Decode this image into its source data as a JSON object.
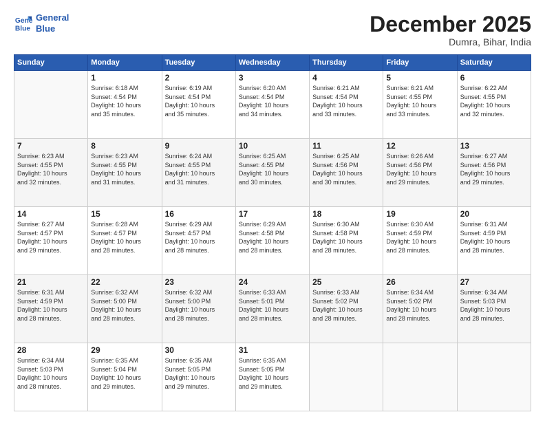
{
  "header": {
    "logo_line1": "General",
    "logo_line2": "Blue",
    "month": "December 2025",
    "location": "Dumra, Bihar, India"
  },
  "days_of_week": [
    "Sunday",
    "Monday",
    "Tuesday",
    "Wednesday",
    "Thursday",
    "Friday",
    "Saturday"
  ],
  "weeks": [
    [
      {
        "day": "",
        "detail": ""
      },
      {
        "day": "1",
        "detail": "Sunrise: 6:18 AM\nSunset: 4:54 PM\nDaylight: 10 hours\nand 35 minutes."
      },
      {
        "day": "2",
        "detail": "Sunrise: 6:19 AM\nSunset: 4:54 PM\nDaylight: 10 hours\nand 35 minutes."
      },
      {
        "day": "3",
        "detail": "Sunrise: 6:20 AM\nSunset: 4:54 PM\nDaylight: 10 hours\nand 34 minutes."
      },
      {
        "day": "4",
        "detail": "Sunrise: 6:21 AM\nSunset: 4:54 PM\nDaylight: 10 hours\nand 33 minutes."
      },
      {
        "day": "5",
        "detail": "Sunrise: 6:21 AM\nSunset: 4:55 PM\nDaylight: 10 hours\nand 33 minutes."
      },
      {
        "day": "6",
        "detail": "Sunrise: 6:22 AM\nSunset: 4:55 PM\nDaylight: 10 hours\nand 32 minutes."
      }
    ],
    [
      {
        "day": "7",
        "detail": "Sunrise: 6:23 AM\nSunset: 4:55 PM\nDaylight: 10 hours\nand 32 minutes."
      },
      {
        "day": "8",
        "detail": "Sunrise: 6:23 AM\nSunset: 4:55 PM\nDaylight: 10 hours\nand 31 minutes."
      },
      {
        "day": "9",
        "detail": "Sunrise: 6:24 AM\nSunset: 4:55 PM\nDaylight: 10 hours\nand 31 minutes."
      },
      {
        "day": "10",
        "detail": "Sunrise: 6:25 AM\nSunset: 4:55 PM\nDaylight: 10 hours\nand 30 minutes."
      },
      {
        "day": "11",
        "detail": "Sunrise: 6:25 AM\nSunset: 4:56 PM\nDaylight: 10 hours\nand 30 minutes."
      },
      {
        "day": "12",
        "detail": "Sunrise: 6:26 AM\nSunset: 4:56 PM\nDaylight: 10 hours\nand 29 minutes."
      },
      {
        "day": "13",
        "detail": "Sunrise: 6:27 AM\nSunset: 4:56 PM\nDaylight: 10 hours\nand 29 minutes."
      }
    ],
    [
      {
        "day": "14",
        "detail": "Sunrise: 6:27 AM\nSunset: 4:57 PM\nDaylight: 10 hours\nand 29 minutes."
      },
      {
        "day": "15",
        "detail": "Sunrise: 6:28 AM\nSunset: 4:57 PM\nDaylight: 10 hours\nand 28 minutes."
      },
      {
        "day": "16",
        "detail": "Sunrise: 6:29 AM\nSunset: 4:57 PM\nDaylight: 10 hours\nand 28 minutes."
      },
      {
        "day": "17",
        "detail": "Sunrise: 6:29 AM\nSunset: 4:58 PM\nDaylight: 10 hours\nand 28 minutes."
      },
      {
        "day": "18",
        "detail": "Sunrise: 6:30 AM\nSunset: 4:58 PM\nDaylight: 10 hours\nand 28 minutes."
      },
      {
        "day": "19",
        "detail": "Sunrise: 6:30 AM\nSunset: 4:59 PM\nDaylight: 10 hours\nand 28 minutes."
      },
      {
        "day": "20",
        "detail": "Sunrise: 6:31 AM\nSunset: 4:59 PM\nDaylight: 10 hours\nand 28 minutes."
      }
    ],
    [
      {
        "day": "21",
        "detail": "Sunrise: 6:31 AM\nSunset: 4:59 PM\nDaylight: 10 hours\nand 28 minutes."
      },
      {
        "day": "22",
        "detail": "Sunrise: 6:32 AM\nSunset: 5:00 PM\nDaylight: 10 hours\nand 28 minutes."
      },
      {
        "day": "23",
        "detail": "Sunrise: 6:32 AM\nSunset: 5:00 PM\nDaylight: 10 hours\nand 28 minutes."
      },
      {
        "day": "24",
        "detail": "Sunrise: 6:33 AM\nSunset: 5:01 PM\nDaylight: 10 hours\nand 28 minutes."
      },
      {
        "day": "25",
        "detail": "Sunrise: 6:33 AM\nSunset: 5:02 PM\nDaylight: 10 hours\nand 28 minutes."
      },
      {
        "day": "26",
        "detail": "Sunrise: 6:34 AM\nSunset: 5:02 PM\nDaylight: 10 hours\nand 28 minutes."
      },
      {
        "day": "27",
        "detail": "Sunrise: 6:34 AM\nSunset: 5:03 PM\nDaylight: 10 hours\nand 28 minutes."
      }
    ],
    [
      {
        "day": "28",
        "detail": "Sunrise: 6:34 AM\nSunset: 5:03 PM\nDaylight: 10 hours\nand 28 minutes."
      },
      {
        "day": "29",
        "detail": "Sunrise: 6:35 AM\nSunset: 5:04 PM\nDaylight: 10 hours\nand 29 minutes."
      },
      {
        "day": "30",
        "detail": "Sunrise: 6:35 AM\nSunset: 5:05 PM\nDaylight: 10 hours\nand 29 minutes."
      },
      {
        "day": "31",
        "detail": "Sunrise: 6:35 AM\nSunset: 5:05 PM\nDaylight: 10 hours\nand 29 minutes."
      },
      {
        "day": "",
        "detail": ""
      },
      {
        "day": "",
        "detail": ""
      },
      {
        "day": "",
        "detail": ""
      }
    ]
  ]
}
